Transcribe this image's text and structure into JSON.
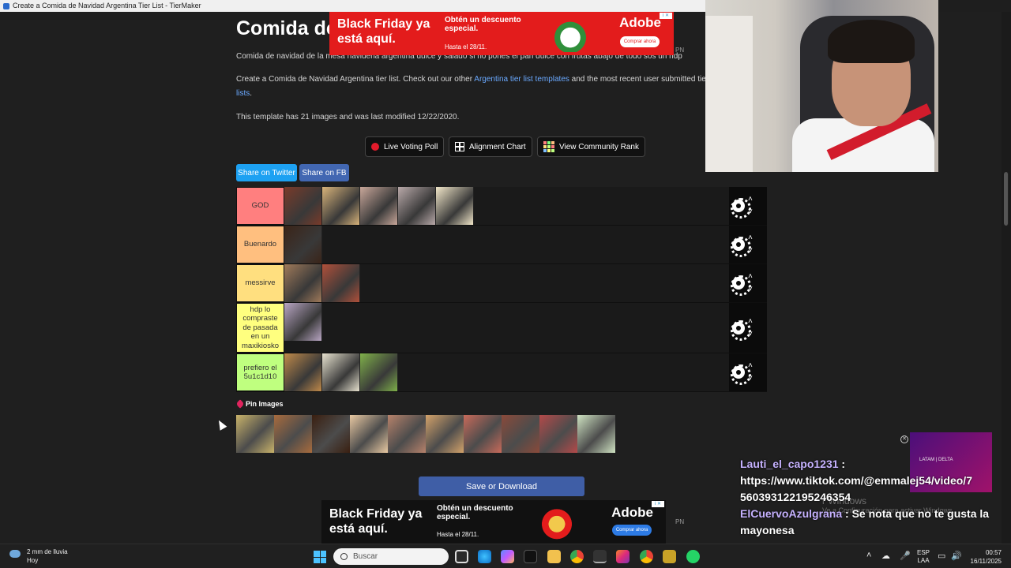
{
  "window": {
    "title": "Create a Comida de Navidad Argentina Tier List - TierMaker"
  },
  "page": {
    "title": "Comida de",
    "subtitle": "Comida de navidad de la mesa navideña argentina dulce y salado si no pones el pan dulce con frutas abajo de todo sos un hdp",
    "intro_prefix": "Create a Comida de Navidad Argentina tier list. Check out our other ",
    "intro_link": "Argentina tier list templates",
    "intro_mid": " and the most recent user submitted tier ",
    "intro_link2": "lists",
    "intro_end": ".",
    "meta": "This template has 21 images and was last modified 12/22/2020."
  },
  "tools": {
    "live_voting": "Live Voting Poll",
    "alignment_chart": "Alignment Chart",
    "community_rank": "View Community Rank"
  },
  "share": {
    "twitter": "Share on Twitter",
    "facebook": "Share on FB"
  },
  "tiers": [
    {
      "label": "GOD",
      "color": "#ff7f7f",
      "items": [
        "#7a3b2a",
        "#d9b47a",
        "#c9a79a",
        "#b9a9a9",
        "#f2e7c9"
      ]
    },
    {
      "label": "Buenardo",
      "color": "#ffbf7f",
      "items": [
        "#3b2418"
      ]
    },
    {
      "label": "messirve",
      "color": "#ffdf7f",
      "items": [
        "#a07a5a",
        "#b0503a"
      ]
    },
    {
      "label": "hdp lo compraste de pasada en un maxikiosko",
      "color": "#ffff7f",
      "items": [
        "#b9a6c4"
      ]
    },
    {
      "label": "prefiero el 5u1c1d10",
      "color": "#bfff7f",
      "items": [
        "#c08a4a",
        "#e7e2cf",
        "#7fb04a"
      ]
    }
  ],
  "pin": {
    "label": "Pin Images"
  },
  "pool": [
    "#c9b36a",
    "#a86b3d",
    "#3a1f10",
    "#e9c9a2",
    "#b7826b",
    "#d3a26a",
    "#c86a5a",
    "#8a4a3a",
    "#b44a4a",
    "#cfe3c2"
  ],
  "save_button": "Save or Download",
  "ads": {
    "headline": "Black Friday ya está aquí.",
    "promo": "Obtén un descuento especial.",
    "until": "Hasta el 28/11.",
    "brand": "Adobe",
    "cta": "Comprar ahora",
    "pn": "PN"
  },
  "chat": [
    {
      "user": "Lauti_el_capo1231",
      "message": "https://www.tiktok.com/@emmalej54/video/7560393122195246354"
    },
    {
      "user": "ElCuervoAzulgrana",
      "message": "Se nota que no te gusta la mayonesa"
    }
  ],
  "overlay": {
    "watermark": "Ve a Configuración para activar Windows.",
    "watermark_big": "r Windows",
    "mini_ad": "LATAM | DELTA"
  },
  "taskbar": {
    "weather_value": "2 mm de lluvia",
    "weather_when": "Hoy",
    "search_placeholder": "Buscar",
    "lang": "ESP",
    "region": "LAA",
    "time": "00:57",
    "date": "16/11/2025"
  }
}
